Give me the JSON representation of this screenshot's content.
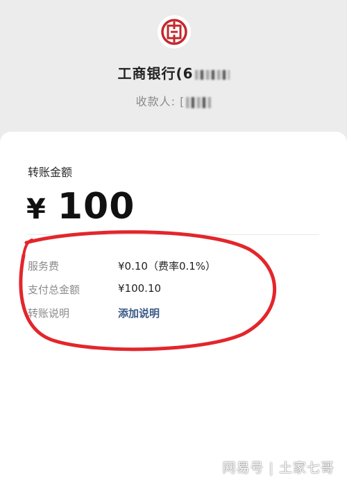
{
  "header": {
    "bank_logo_icon": "icbc-logo-icon",
    "bank_name": "工商银行(6",
    "payee_label": "收款人: [",
    "brand_color": "#c3282d"
  },
  "transfer": {
    "amount_label": "转账金额",
    "currency": "¥",
    "amount": "100"
  },
  "details": {
    "fee_label": "服务费",
    "fee_value": "¥0.10（费率0.1%）",
    "total_label": "支付总金额",
    "total_value": "¥100.10",
    "note_label": "转账说明",
    "note_action": "添加说明",
    "link_color": "#3a5a86"
  },
  "annotation": {
    "color": "#e3262b"
  },
  "watermark": "网易号 | 土家七哥"
}
